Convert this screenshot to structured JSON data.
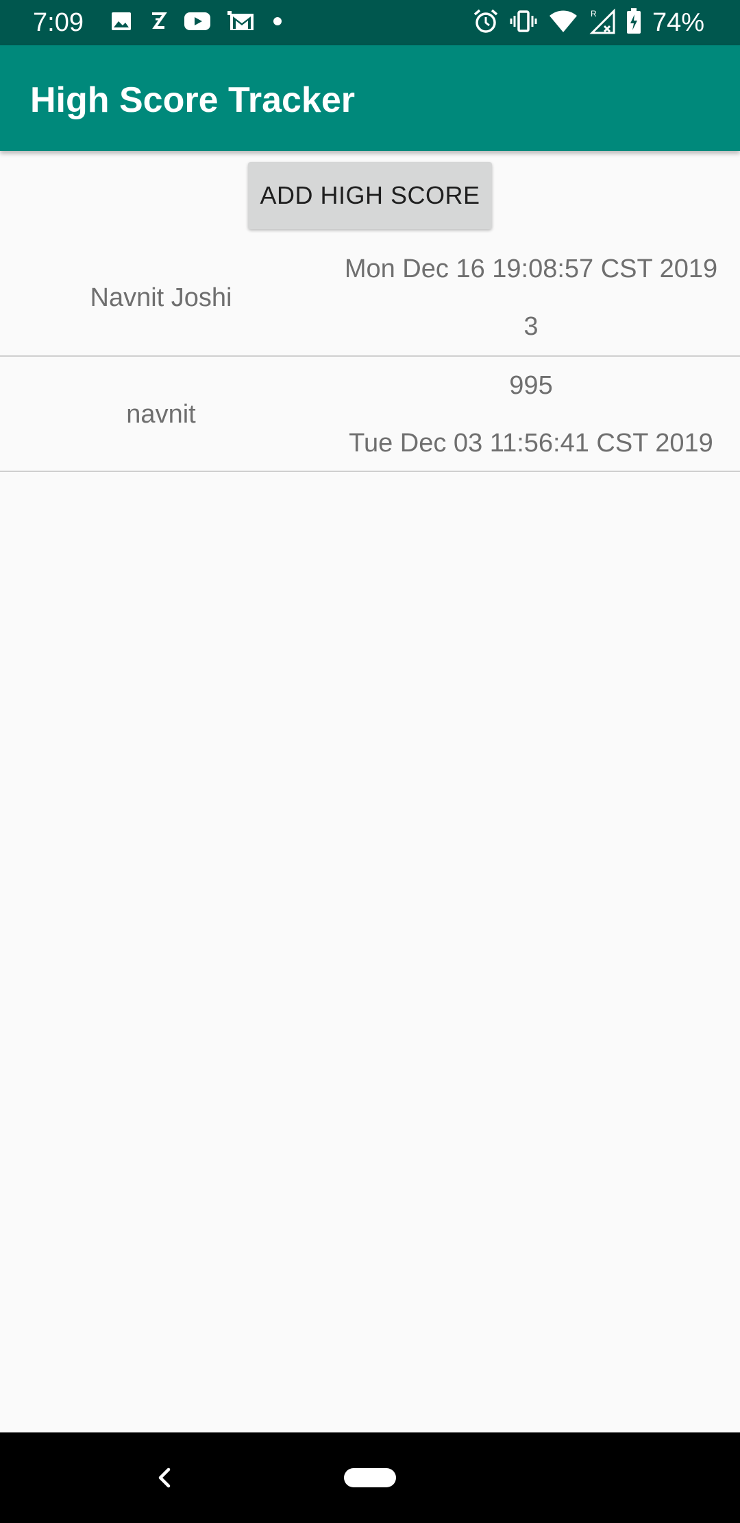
{
  "status_bar": {
    "time": "7:09",
    "battery": "74%",
    "left_icons": [
      "image-icon",
      "zomato-icon",
      "youtube-icon",
      "gmail-icon",
      "dot-icon"
    ],
    "right_icons": [
      "alarm-icon",
      "vibrate-icon",
      "wifi-icon",
      "signal-icon",
      "battery-charging-icon"
    ]
  },
  "app_bar": {
    "title": "High Score Tracker",
    "color": "#00897b"
  },
  "actions": {
    "add_label": "ADD HIGH SCORE"
  },
  "scores": [
    {
      "name": "Navnit Joshi",
      "date": "Mon Dec 16 19:08:57 CST 2019",
      "score": "3"
    },
    {
      "name": "navnit",
      "score": "995",
      "date": "Tue Dec 03 11:56:41 CST 2019"
    }
  ],
  "nav_bar": {
    "icons": [
      "back-icon",
      "home-icon"
    ]
  }
}
